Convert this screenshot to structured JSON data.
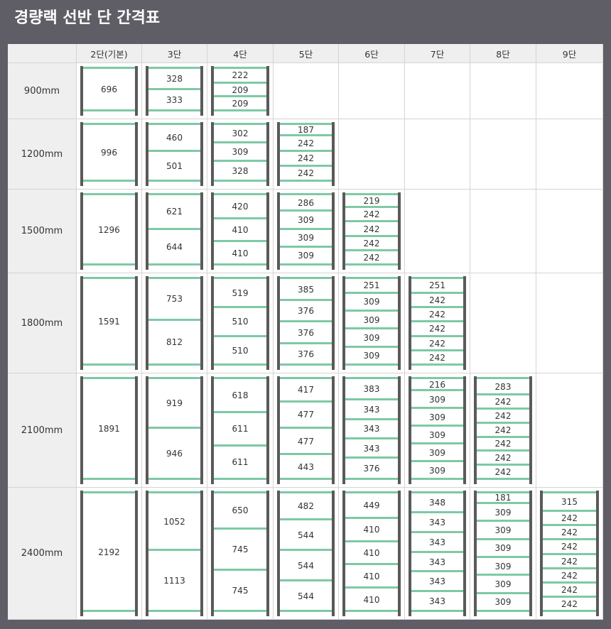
{
  "title": "경량랙 선반 단 간격표",
  "colors": {
    "header_bg": "#5f5e66",
    "post": "#5a5a5a",
    "shelf": "#7ec9a4",
    "header_cell": "#efefef"
  },
  "columns": [
    "",
    "2단(기본)",
    "3단",
    "4단",
    "5단",
    "6단",
    "7단",
    "8단",
    "9단"
  ],
  "rows": [
    {
      "label": "900mm",
      "racks": [
        [
          696
        ],
        [
          328,
          333
        ],
        [
          222,
          209,
          209
        ]
      ]
    },
    {
      "label": "1200mm",
      "racks": [
        [
          996
        ],
        [
          460,
          501
        ],
        [
          302,
          309,
          328
        ],
        [
          187,
          242,
          242,
          242
        ]
      ]
    },
    {
      "label": "1500mm",
      "racks": [
        [
          1296
        ],
        [
          621,
          644
        ],
        [
          420,
          410,
          410
        ],
        [
          286,
          309,
          309,
          309
        ],
        [
          219,
          242,
          242,
          242,
          242
        ]
      ]
    },
    {
      "label": "1800mm",
      "racks": [
        [
          1591
        ],
        [
          753,
          812
        ],
        [
          519,
          510,
          510
        ],
        [
          385,
          376,
          376,
          376
        ],
        [
          251,
          309,
          309,
          309,
          309
        ],
        [
          251,
          242,
          242,
          242,
          242,
          242
        ]
      ]
    },
    {
      "label": "2100mm",
      "racks": [
        [
          1891
        ],
        [
          919,
          946
        ],
        [
          618,
          611,
          611
        ],
        [
          417,
          477,
          477,
          443
        ],
        [
          383,
          343,
          343,
          343,
          376
        ],
        [
          216,
          309,
          309,
          309,
          309,
          309
        ],
        [
          283,
          242,
          242,
          242,
          242,
          242,
          242
        ]
      ]
    },
    {
      "label": "2400mm",
      "racks": [
        [
          2192
        ],
        [
          1052,
          1113
        ],
        [
          650,
          745,
          745
        ],
        [
          482,
          544,
          544,
          544
        ],
        [
          449,
          410,
          410,
          410,
          410
        ],
        [
          348,
          343,
          343,
          343,
          343,
          343
        ],
        [
          181,
          309,
          309,
          309,
          309,
          309,
          309
        ],
        [
          315,
          242,
          242,
          242,
          242,
          242,
          242,
          242
        ]
      ]
    }
  ]
}
